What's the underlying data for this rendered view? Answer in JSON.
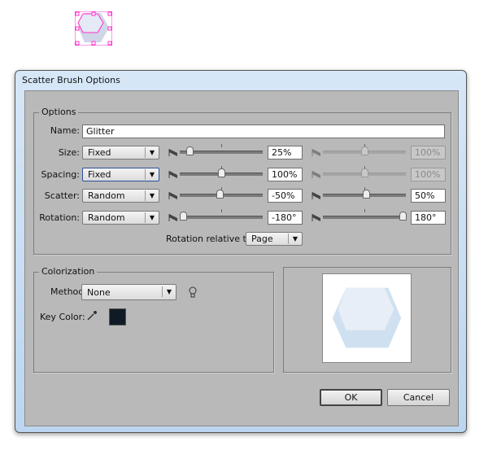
{
  "dialog": {
    "title": "Scatter Brush Options"
  },
  "options": {
    "group_label": "Options",
    "name_label": "Name:",
    "name_value": "Glitter",
    "rows": [
      {
        "label": "Size:",
        "method": "Fixed",
        "min_value": "25%",
        "max_value": "100%",
        "min_pos": 0.12,
        "max_pos": 0.5,
        "max_disabled": true,
        "focused": false
      },
      {
        "label": "Spacing:",
        "method": "Fixed",
        "min_value": "100%",
        "max_value": "100%",
        "min_pos": 0.5,
        "max_pos": 0.5,
        "max_disabled": true,
        "focused": true
      },
      {
        "label": "Scatter:",
        "method": "Random",
        "min_value": "-50%",
        "max_value": "50%",
        "min_pos": 0.48,
        "max_pos": 0.52,
        "max_disabled": false,
        "focused": false
      },
      {
        "label": "Rotation:",
        "method": "Random",
        "min_value": "-180°",
        "max_value": "180°",
        "min_pos": 0.04,
        "max_pos": 0.96,
        "max_disabled": false,
        "focused": false
      }
    ],
    "rotation_relative_label": "Rotation relative to:",
    "rotation_relative_value": "Page"
  },
  "colorization": {
    "group_label": "Colorization",
    "method_label": "Method:",
    "method_value": "None",
    "key_color_label": "Key Color:",
    "key_color": "#0f1a26"
  },
  "buttons": {
    "ok": "OK",
    "cancel": "Cancel"
  },
  "colors": {
    "hex_outer": "#cfe1f0",
    "hex_inner": "#e8eef8",
    "selection": "#ff33cc"
  }
}
